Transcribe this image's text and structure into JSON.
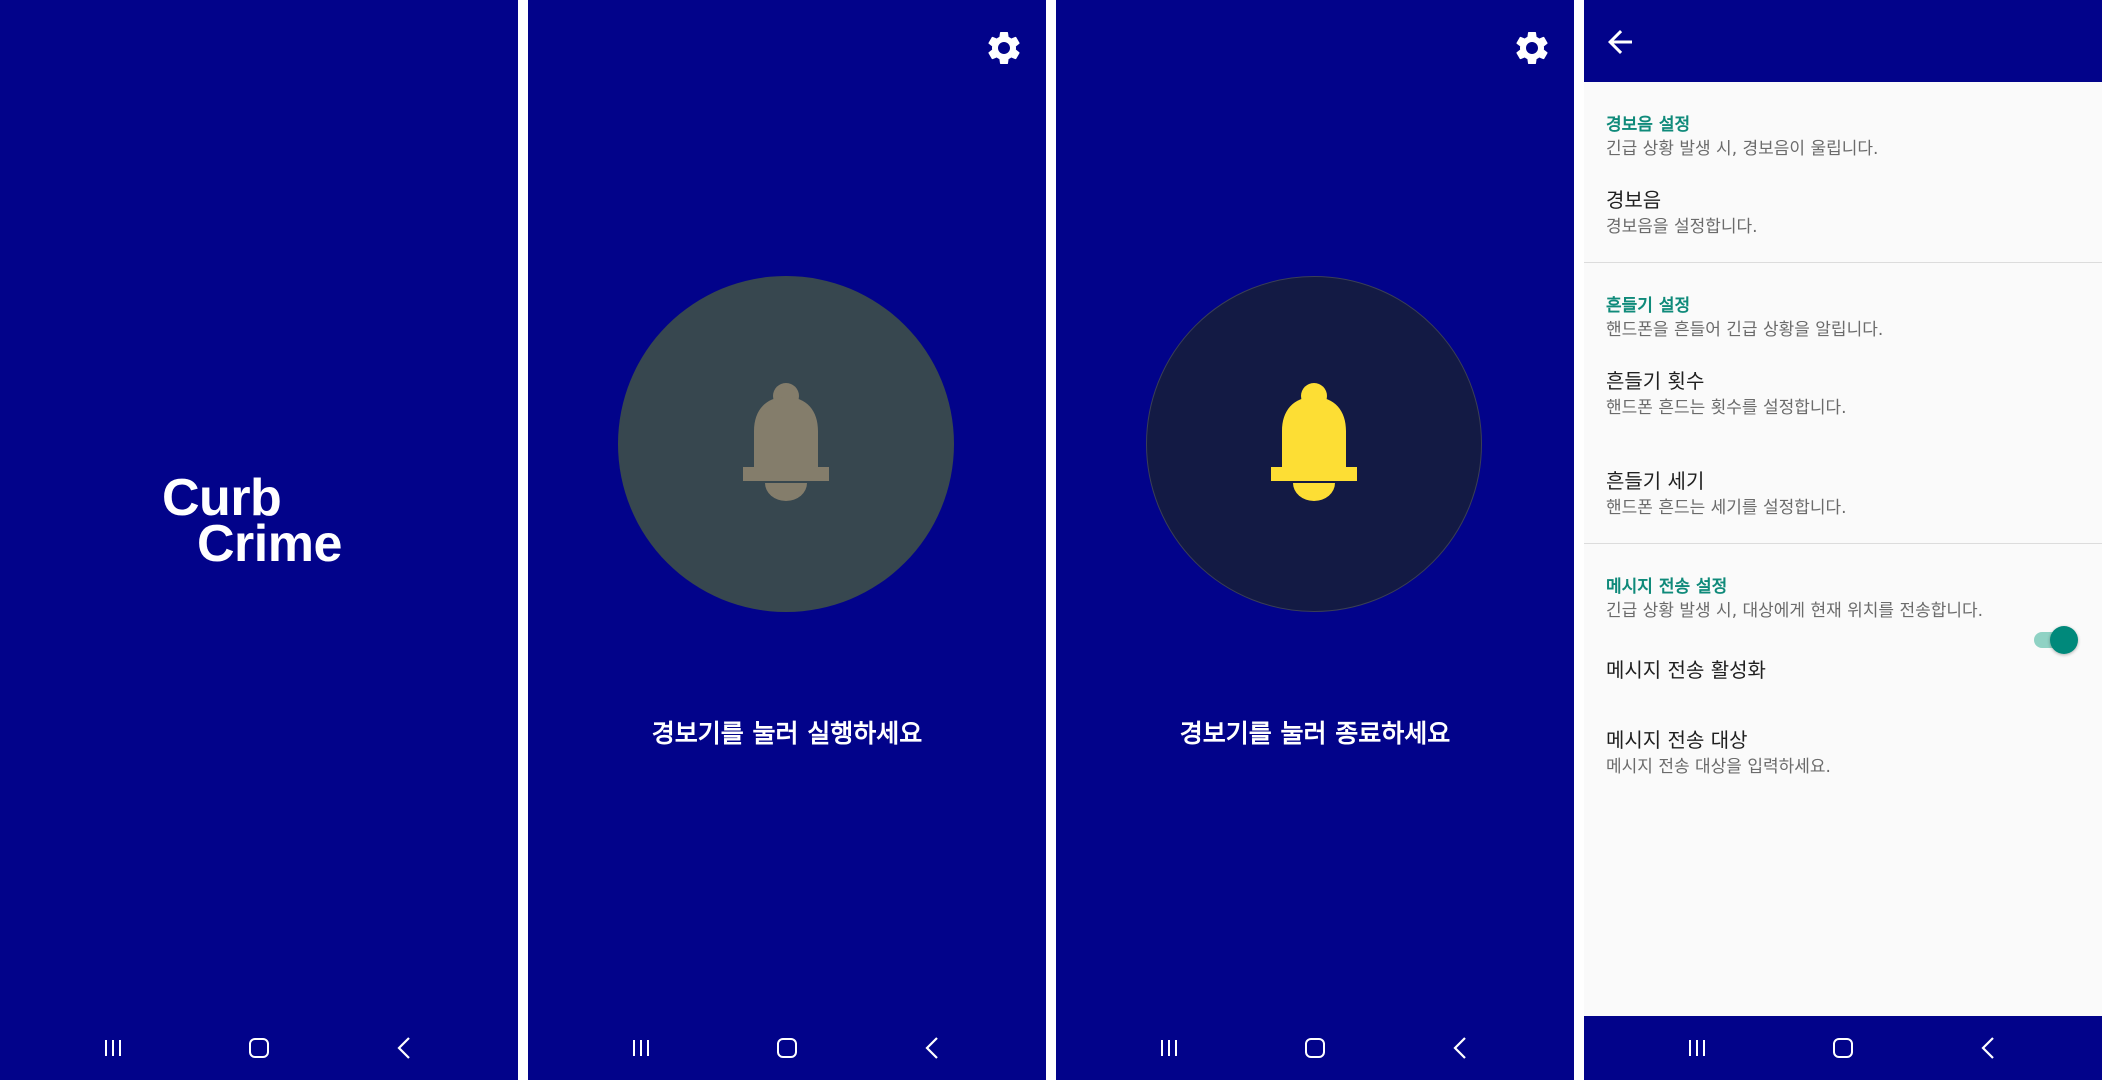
{
  "splash": {
    "logo_line1": "Curb",
    "logo_line2": "Crime"
  },
  "alarm_off": {
    "caption": "경보기를 눌러 실행하세요",
    "bell_color": "#847d6b",
    "circle_color": "#37474f"
  },
  "alarm_on": {
    "caption": "경보기를 눌러 종료하세요",
    "bell_color": "#fdde34",
    "circle_color": "#131a44"
  },
  "settings": {
    "categories": [
      {
        "title": "경보음 설정",
        "desc": "긴급 상황 발생 시, 경보음이 울립니다.",
        "prefs": [
          {
            "title": "경보음",
            "summary": "경보음을 설정합니다."
          }
        ]
      },
      {
        "title": "흔들기 설정",
        "desc": "핸드폰을 흔들어 긴급 상황을 알립니다.",
        "prefs": [
          {
            "title": "흔들기 횟수",
            "summary": "핸드폰 흔드는 횟수를 설정합니다."
          },
          {
            "title": "흔들기 세기",
            "summary": "핸드폰 흔드는 세기를 설정합니다."
          }
        ]
      },
      {
        "title": "메시지 전송 설정",
        "desc": "긴급 상황 발생 시, 대상에게 현재 위치를 전송합니다.",
        "prefs": [
          {
            "title": "메시지 전송 활성화",
            "switch_on": true
          },
          {
            "title": "메시지 전송 대상",
            "summary": "메시지 전송 대상을 입력하세요."
          }
        ]
      }
    ]
  },
  "colors": {
    "primary": "#02038a",
    "accent": "#0f8a7a"
  },
  "icons": {
    "settings": "gear-icon",
    "back": "arrow-back-icon",
    "bell": "bell-icon",
    "nav_recents": "recents-icon",
    "nav_home": "home-icon",
    "nav_back": "back-icon"
  }
}
